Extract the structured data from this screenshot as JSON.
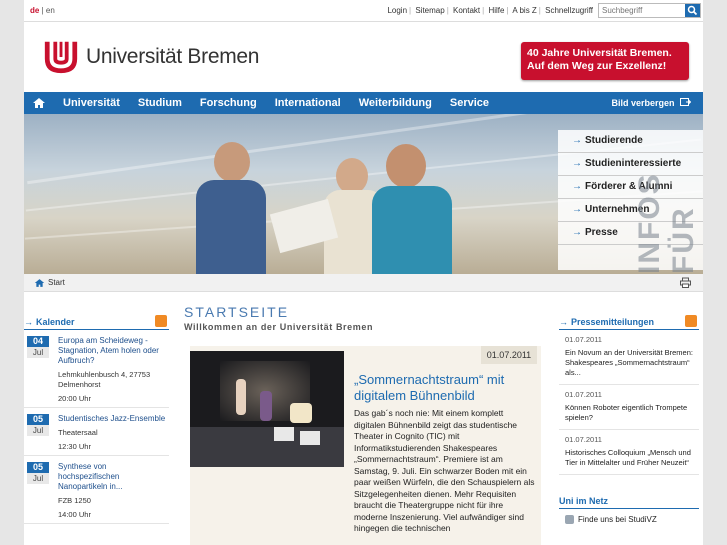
{
  "lang": {
    "de": "de",
    "sep": "|",
    "en": "en"
  },
  "utility": [
    "Login",
    "Sitemap",
    "Kontakt",
    "Hilfe",
    "A bis Z",
    "Schnellzugriff"
  ],
  "search": {
    "placeholder": "Suchbegriff"
  },
  "logo": {
    "text": "Universität Bremen"
  },
  "promo": {
    "line1": "40 Jahre Universität Bremen.",
    "line2": "Auf dem Weg zur Exzellenz!"
  },
  "nav": {
    "items": [
      "Universität",
      "Studium",
      "Forschung",
      "International",
      "Weiterbildung",
      "Service"
    ],
    "hide_label": "Bild verbergen"
  },
  "hero": {
    "audience": [
      "Studierende",
      "Studieninteressierte",
      "Förderer & Alumni",
      "Unternehmen",
      "Presse"
    ],
    "infos": "INFOS FÜR"
  },
  "breadcrumb": {
    "start": "Start"
  },
  "kalender": {
    "heading": "Kalender",
    "events": [
      {
        "day": "04",
        "month": "Jul",
        "title": "Europa am Scheideweg - Stagnation, Atem holen oder Aufbruch?",
        "loc": "Lehmkuhlenbusch 4, 27753 Delmenhorst",
        "time": "20:00 Uhr"
      },
      {
        "day": "05",
        "month": "Jul",
        "title": "Studentisches Jazz-Ensemble",
        "loc": "Theatersaal",
        "time": "12:30 Uhr"
      },
      {
        "day": "05",
        "month": "Jul",
        "title": "Synthese von hochspezifischen Nanopartikeln in...",
        "loc": "FZB 1250",
        "time": "14:00 Uhr"
      }
    ]
  },
  "main": {
    "title": "STARTSEITE",
    "subtitle": "Willkommen an der Universität Bremen",
    "news": {
      "date": "01.07.2011",
      "title": "„Sommernachtstraum“ mit digitalem Bühnenbild",
      "body": "Das gab´s noch nie: Mit einem komplett digitalen Bühnenbild zeigt das studentische Theater in Cognito (TIC) mit Informatikstudierenden Shakespeares „Sommernachtstraum“. Premiere ist am Samstag, 9. Juli. Ein schwarzer Boden mit ein paar weißen Würfeln, die den Schauspielern als Sitzgelegenheiten dienen. Mehr Requisiten braucht die Theatergruppe nicht für ihre moderne Inszenierung. Viel aufwändiger sind hingegen die technischen"
    }
  },
  "presse": {
    "heading": "Pressemitteilungen",
    "items": [
      {
        "date": "01.07.2011",
        "text": "Ein Novum an der Universität Bremen: Shakespeares „Sommernachtstraum“ als..."
      },
      {
        "date": "01.07.2011",
        "text": "Können Roboter eigentlich Trompete spielen?"
      },
      {
        "date": "01.07.2011",
        "text": "Historisches Colloquium „Mensch und Tier in Mittelalter und Früher Neuzeit“"
      }
    ]
  },
  "netz": {
    "heading": "Uni im Netz",
    "links": [
      "Finde uns bei StudiVZ"
    ]
  },
  "colors": {
    "brand_red": "#c8102e",
    "nav_blue": "#1e6bb0",
    "rss_orange": "#f08a24"
  }
}
